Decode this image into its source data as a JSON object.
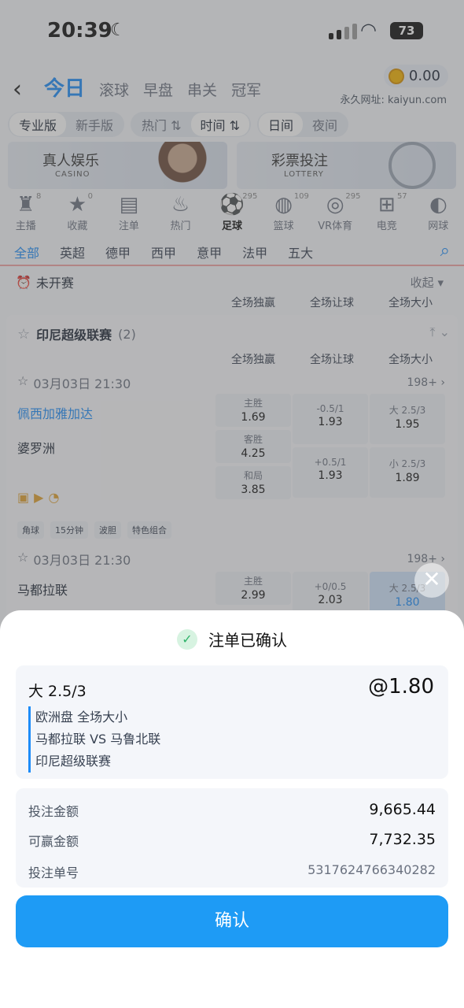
{
  "status_bar": {
    "time": "20:39",
    "battery": "73"
  },
  "header": {
    "tabs": [
      "今日",
      "滚球",
      "早盘",
      "串关",
      "冠军"
    ],
    "balance": "0.00",
    "url_label": "永久网址: kaiyun.com"
  },
  "filters": {
    "mode": [
      "专业版",
      "新手版"
    ],
    "sort": [
      "热门 ⇅",
      "时间 ⇅"
    ],
    "view": [
      "日间",
      "夜间"
    ]
  },
  "banners": [
    {
      "title": "真人娱乐",
      "sub": "CASINO"
    },
    {
      "title": "彩票投注",
      "sub": "LOTTERY"
    }
  ],
  "sports": [
    {
      "label": "主播",
      "count": "8"
    },
    {
      "label": "收藏",
      "count": "0"
    },
    {
      "label": "注单",
      "count": ""
    },
    {
      "label": "热门",
      "count": ""
    },
    {
      "label": "足球",
      "count": "295"
    },
    {
      "label": "篮球",
      "count": "109"
    },
    {
      "label": "VR体育",
      "count": "295"
    },
    {
      "label": "电竞",
      "count": "57"
    },
    {
      "label": "网球",
      "count": ""
    }
  ],
  "leagues": [
    "全部",
    "英超",
    "德甲",
    "西甲",
    "意甲",
    "法甲",
    "五大"
  ],
  "section": {
    "title": "未开赛",
    "fold": "收起"
  },
  "columns": [
    "全场独赢",
    "全场让球",
    "全场大小"
  ],
  "league": {
    "name": "印尼超级联赛",
    "count": "(2)",
    "match1": {
      "date": "03月03日 21:30",
      "more": "198+",
      "home": "佩西加雅加达",
      "away": "婆罗洲",
      "odds": {
        "home_label": "主胜",
        "home": "1.69",
        "away_label": "客胜",
        "away": "4.25",
        "draw_label": "和局",
        "draw": "3.85",
        "hcp1_label": "-0.5/1",
        "hcp1": "1.93",
        "hcp2_label": "+0.5/1",
        "hcp2": "1.93",
        "ou1_label": "大 2.5/3",
        "ou1": "1.95",
        "ou2_label": "小 2.5/3",
        "ou2": "1.89"
      },
      "chips": [
        "角球",
        "15分钟",
        "波胆",
        "特色组合"
      ]
    },
    "match2": {
      "date": "03月03日 21:30",
      "more": "198+",
      "home": "马都拉联",
      "odds": {
        "home_label": "主胜",
        "home": "2.99",
        "hcp1_label": "+0/0.5",
        "hcp1": "2.03",
        "ou1_label": "大 2.5/3",
        "ou1": "1.80"
      }
    }
  },
  "sheet": {
    "title": "注单已确认",
    "selection": "大 2.5/3",
    "odds": "@1.80",
    "market": "欧洲盘 全场大小",
    "match": "马都拉联 VS 马鲁北联",
    "league": "印尼超级联赛",
    "stake_label": "投注金额",
    "stake": "9,665.44",
    "win_label": "可赢金额",
    "win": "7,732.35",
    "ticket_label": "投注单号",
    "ticket": "5317624766340282",
    "confirm": "确认"
  }
}
